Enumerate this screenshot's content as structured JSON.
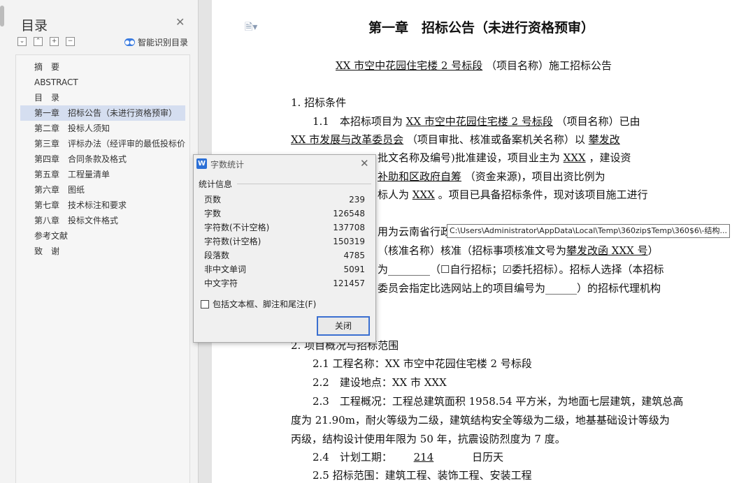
{
  "toc": {
    "title": "目录",
    "smart_label": "智能识别目录",
    "tool_glyphs": [
      "⌄",
      "⌃",
      "+",
      "−"
    ],
    "items": [
      "摘　要",
      "ABSTRACT",
      "目　录",
      "第一章　招标公告（未进行资格预审）",
      "第二章　投标人须知",
      "第三章　评标办法（经评审的最低投标价法）",
      "第四章　合同条款及格式",
      "第五章　工程量清单",
      "第六章　图纸",
      "第七章　技术标注和要求",
      "第八章　投标文件格式",
      "参考文献",
      "致　谢"
    ],
    "selected_index": 3
  },
  "doc": {
    "chapter_title": "第一章　招标公告（未进行资格预审）",
    "subtitle_project": "XX 市空中花园住宅楼 2 号标段",
    "subtitle_rest": "（项目名称）施工招标公告",
    "s1_heading": "1. 招标条件",
    "p1_1_a": "1.1　本招标项目为",
    "p1_1_proj": "XX 市空中花园住宅楼 2 号标段",
    "p1_1_b": "（项目名称）已由",
    "p1_2_org": "XX 市发展与改革委员会",
    "p1_2_b": "（项目审批、核准或备案机关名称）以",
    "p1_2_c": "攀发改",
    "p1_3_a": "批文名称及编号)批准建设，项目业主为",
    "p1_3_owner": "XXX",
    "p1_3_b": "，建设资",
    "p1_4_a": "补助和区政府自筹",
    "p1_4_b": "（资金来源)，项目出资比例为",
    "p1_5_a": "标人为",
    "p1_5_who": "XXX",
    "p1_5_b": "。项目已具备招标条件，现对该项目施工进行",
    "p1_6_a": "用为云南省行政",
    "p1_7_a": "（核准名称）核准（招标事项核准文号为",
    "p1_7_doc": "攀发改函 XXX 号",
    "p1_7_b": "）",
    "p1_8_a": "为________（",
    "p1_8_b": "自行招标；",
    "p1_8_c": "委托招标）。招标人选择（本招标",
    "p1_9_a": "委员会指定比选网站上的项目编号为______）的招标代理机构",
    "s2_heading": "2. 项目概况与招标范围",
    "p2_1": "2.1 工程名称：XX 市空中花园住宅楼 2 号标段",
    "p2_2": "2.2　建设地点：XX 市 XXX",
    "p2_3a": "2.3　工程概况：工程总建筑面积 1958.54 平方米，为地面七层建筑，建筑总高",
    "p2_3b": "度为 21.90m，耐火等级为二级，建筑结构安全等级为二级，地基基础设计等级为",
    "p2_3c": "丙级，结构设计使用年限为 50 年，抗震设防烈度为 7 度。",
    "p2_4a": "2.4　计划工期：",
    "p2_4days": "214",
    "p2_4b": "日历天",
    "p2_5": "2.5 招标范围：建筑工程、装饰工程、安装工程"
  },
  "tooltip": "C:\\Users\\Administrator\\AppData\\Local\\Temp\\360zip$Temp\\360$6\\-结构...",
  "dialog": {
    "title": "字数统计",
    "section": "统计信息",
    "stats": [
      {
        "label": "页数",
        "value": "239"
      },
      {
        "label": "字数",
        "value": "126548"
      },
      {
        "label": "字符数(不计空格)",
        "value": "137708"
      },
      {
        "label": "字符数(计空格)",
        "value": "150319"
      },
      {
        "label": "段落数",
        "value": "4785"
      },
      {
        "label": "非中文单词",
        "value": "5091"
      },
      {
        "label": "中文字符",
        "value": "121457"
      }
    ],
    "checkbox_label": "包括文本框、脚注和尾注(F)",
    "close_button": "关闭"
  }
}
